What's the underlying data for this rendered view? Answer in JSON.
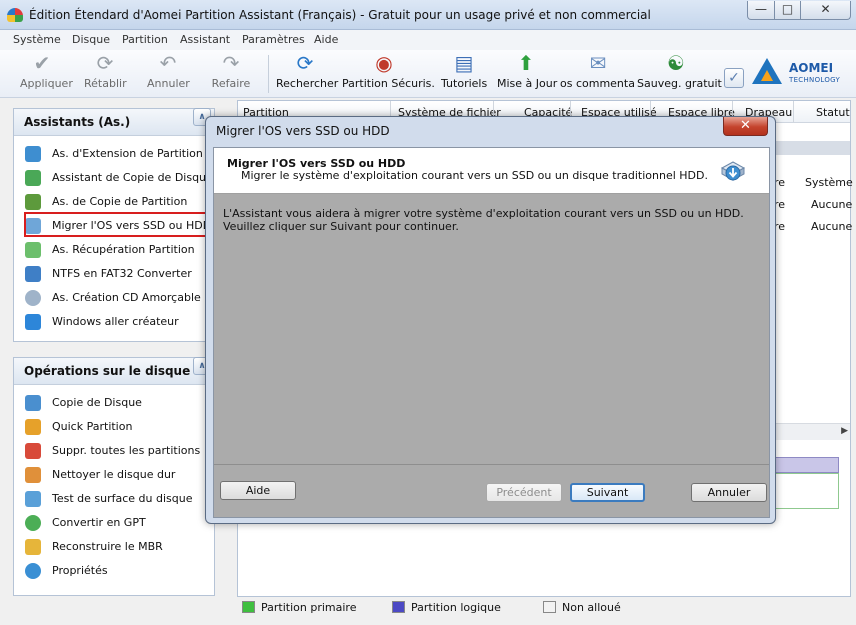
{
  "window": {
    "title": "Édition Étendard d'Aomei Partition Assistant (Français) - Gratuit pour un usage privé et non commercial"
  },
  "menu": [
    "Système",
    "Disque",
    "Partition",
    "Assistant",
    "Paramètres",
    "Aide"
  ],
  "toolbar": {
    "apply": "Appliquer",
    "undo_last": "Rétablir",
    "undo": "Annuler",
    "redo": "Refaire",
    "search": "Rechercher",
    "safe_partition": "Partition Sécuris.",
    "tutorials": "Tutoriels",
    "update": "Mise à Jour",
    "comment": "os commentaire",
    "backup": "Sauveg. gratuit",
    "logo_name": "AOMEI",
    "logo_sub": "TECHNOLOGY"
  },
  "panel_wizards": {
    "title": "Assistants (As.)",
    "items": [
      "As. d'Extension de Partition",
      "Assistant de Copie de Disque",
      "As. de Copie de Partition",
      "Migrer l'OS vers SSD ou HDD",
      "As. Récupération Partition",
      "NTFS en FAT32 Converter",
      "As. Création CD Amorçable",
      "Windows aller créateur"
    ]
  },
  "panel_disk": {
    "title": "Opérations sur le disque",
    "items": [
      "Copie de Disque",
      "Quick Partition",
      "Suppr. toutes les partitions",
      "Nettoyer le disque dur",
      "Test de surface du disque",
      "Convertir en GPT",
      "Reconstruire le MBR",
      "Propriétés"
    ]
  },
  "table": {
    "columns": [
      "Partition",
      "Système de fichier",
      "Capacité",
      "Espace utilisé",
      "Espace libre",
      "Drapeau",
      "Statut"
    ],
    "visible_cells": [
      {
        "col5": "re",
        "col6": "Système"
      },
      {
        "col5": "re",
        "col6": "Aucune"
      },
      {
        "col5": "re",
        "col6": "Aucune"
      }
    ]
  },
  "legend": [
    "Partition primaire",
    "Partition logique",
    "Non alloué"
  ],
  "colors": {
    "primary": "#3fbf3f",
    "logical": "#4c49c4",
    "unallocated": "#f2f2f2",
    "highlight": "#d81e1e"
  },
  "dialog": {
    "title": "Migrer l'OS vers SSD ou HDD",
    "header_title": "Migrer l'OS vers SSD ou HDD",
    "header_subtitle": "Migrer le système d'exploitation courant vers un SSD ou un disque traditionnel HDD.",
    "body": "L'Assistant vous aidera à migrer votre système d'exploitation courant vers un SSD ou un HDD. Veuillez cliquer sur Suivant pour continuer.",
    "help": "Aide",
    "previous": "Précédent",
    "next": "Suivant",
    "cancel": "Annuler"
  }
}
